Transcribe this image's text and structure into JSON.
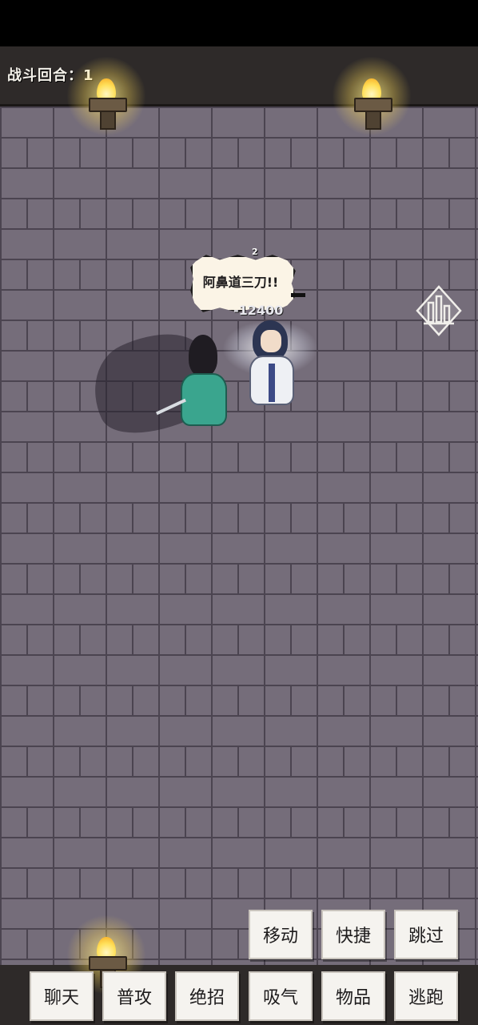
{
  "hud": {
    "round_text": "战斗回合：1"
  },
  "battle": {
    "speech_bubble_text": "阿鼻道三刀!!",
    "speech_counter": "2",
    "damage_text": "-12400"
  },
  "icons": {
    "torch": "torch-icon",
    "stats": "bar-chart-icon"
  },
  "actions_top": [
    {
      "label": "移动"
    },
    {
      "label": "快捷"
    },
    {
      "label": "跳过"
    }
  ],
  "actions_bottom": [
    {
      "label": "聊天"
    },
    {
      "label": "普攻"
    },
    {
      "label": "绝招"
    },
    {
      "label": "吸气"
    },
    {
      "label": "物品"
    },
    {
      "label": "逃跑"
    }
  ],
  "colors": {
    "floor": "#756d7a",
    "brick_line": "#4b4450",
    "bar": "#2e2a29",
    "button": "#f5f3ef"
  }
}
